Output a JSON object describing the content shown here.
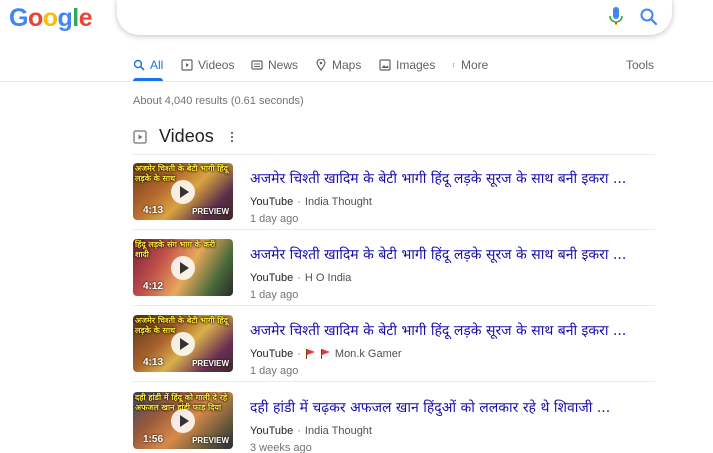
{
  "logo": {
    "letters": [
      "G",
      "o",
      "o",
      "g",
      "l",
      "e"
    ]
  },
  "search": {
    "value": "",
    "placeholder": ""
  },
  "tabs": [
    {
      "label": "All",
      "icon": "search-icon",
      "active": true
    },
    {
      "label": "Videos",
      "icon": "video-icon"
    },
    {
      "label": "News",
      "icon": "news-icon"
    },
    {
      "label": "Maps",
      "icon": "map-pin-icon"
    },
    {
      "label": "Images",
      "icon": "image-icon"
    },
    {
      "label": "More",
      "icon": "more-vert-icon"
    }
  ],
  "tools_label": "Tools",
  "stats": "About 4,040 results (0.61 seconds)",
  "videos_section": {
    "title": "Videos"
  },
  "videos": [
    {
      "title": "अजमेर चिश्ती खादिम के बेटी भागी हिंदू लड़के सूरज के साथ बनी इकरा ...",
      "source": "YouTube",
      "channel": "India Thought",
      "date": "1 day ago",
      "duration": "4:13",
      "preview": "PREVIEW",
      "caption": "अजमेर चिश्ती के बेटी भागी हिंदू लड़के के साथ"
    },
    {
      "title": "अजमेर चिश्ती खादिम के बेटी भागी हिंदू लड़के सूरज के साथ बनी इकरा ...",
      "source": "YouTube",
      "channel": "H O India",
      "date": "1 day ago",
      "duration": "4:12",
      "preview": "",
      "caption": "हिंदू लड़के संग भाग के करी शादी"
    },
    {
      "title": "अजमेर चिश्ती खादिम के बेटी भागी हिंदू लड़के सूरज के साथ बनी इकरा ...",
      "source": "YouTube",
      "channel": "Mon.k Gamer",
      "channel_flags": true,
      "date": "1 day ago",
      "duration": "4:13",
      "preview": "PREVIEW",
      "caption": "अजमेर चिश्ती के बेटी भागी हिंदू लड़के के साथ"
    },
    {
      "title": "दही हांडी में चढ़कर अफजल खान हिंदुओं को ललकार रहे थे शिवाजी ...",
      "source": "YouTube",
      "channel": "India Thought",
      "date": "3 weeks ago",
      "duration": "1:56",
      "preview": "PREVIEW",
      "caption": "दही हांडी में हिंदू को गाली दे रहे अफजल खान हांडी फाड़ दिया"
    }
  ],
  "colors": {
    "link": "#1a0dab",
    "accent": "#1a73e8"
  }
}
